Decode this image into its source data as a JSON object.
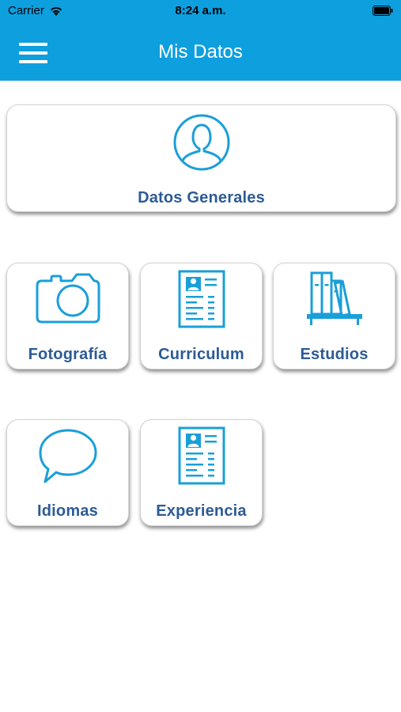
{
  "status_bar": {
    "carrier": "Carrier",
    "time": "8:24 a.m.",
    "icons": [
      "wifi-icon",
      "battery-icon"
    ]
  },
  "nav": {
    "title": "Mis Datos",
    "menu_icon": "hamburger-menu-icon"
  },
  "colors": {
    "primary": "#0e9fdf",
    "icon_blue": "#1a9fd8",
    "label_blue": "#2c5b95",
    "background": "#ffffff"
  },
  "sections": {
    "datos_generales": {
      "label": "Datos Generales",
      "icon": "user-profile-icon"
    },
    "fotografia": {
      "label": "Fotografía",
      "icon": "camera-icon"
    },
    "curriculum": {
      "label": "Curriculum",
      "icon": "resume-document-icon"
    },
    "estudios": {
      "label": "Estudios",
      "icon": "bookshelf-icon"
    },
    "idiomas": {
      "label": "Idiomas",
      "icon": "speech-bubble-icon"
    },
    "experiencia": {
      "label": "Experiencia",
      "icon": "resume-document-icon"
    }
  }
}
